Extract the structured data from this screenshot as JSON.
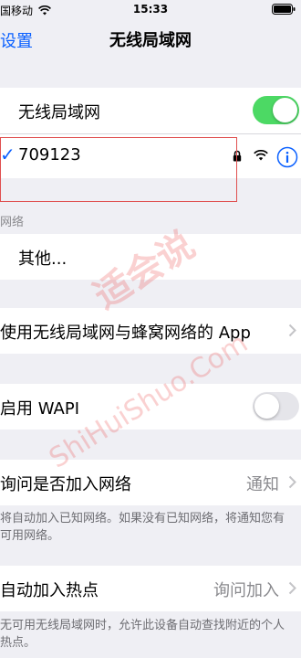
{
  "status": {
    "carrier": "国移动",
    "time": "15:33"
  },
  "nav": {
    "back_label": "设置",
    "title": "无线局域网"
  },
  "wifi_toggle": {
    "label": "无线局域网",
    "on": true
  },
  "connected_network": {
    "name": "709123",
    "checkmark": "✓",
    "icons": [
      "lock-icon",
      "wifi-icon",
      "info-icon"
    ]
  },
  "networks_section": {
    "header": "网络",
    "other_label": "其他..."
  },
  "apps_row": {
    "label": "使用无线局域网与蜂窝网络的 App"
  },
  "wapi_toggle": {
    "label": "启用 WAPI",
    "on": false
  },
  "ask_join": {
    "label": "询问是否加入网络",
    "value": "通知",
    "footer": "将自动加入已知网络。如果没有已知网络，将通知您有可用网络。"
  },
  "auto_hotspot": {
    "label": "自动加入热点",
    "value": "询问加入",
    "footer": "无可用无线局域网时，允许此设备自动查找附近的个人热点。"
  },
  "watermark": {
    "cn": "适会说",
    "en": "ShiHuiShuo.Com"
  },
  "colors": {
    "accent": "#0a60ff",
    "toggle_on": "#4cd964",
    "toggle_off": "#e5e5ea",
    "background": "#efeff4"
  }
}
